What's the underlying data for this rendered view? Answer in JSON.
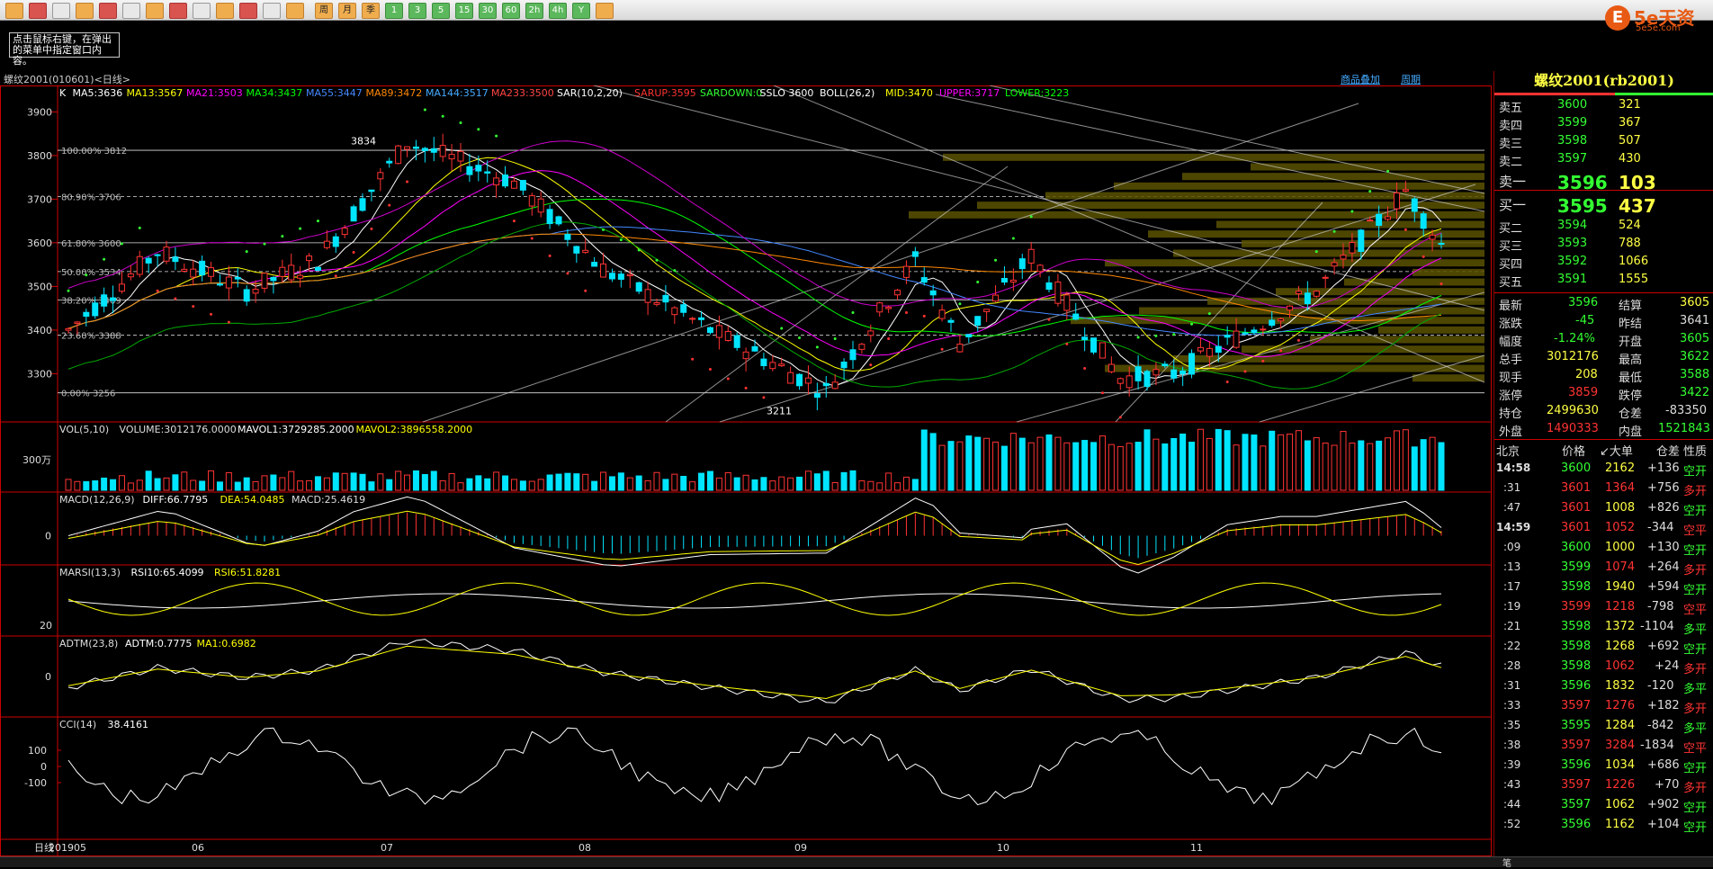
{
  "tip": "点击鼠标右键，在弹出的菜单中指定窗口内容。",
  "chart_header": {
    "name": "螺纹2001(010601)<日线>",
    "overlay": "商品叠加",
    "period": "周期"
  },
  "indicators": {
    "k": [
      [
        "K",
        "#fff"
      ],
      [
        "MA5:3636",
        "#fff"
      ],
      [
        "MA13:3567",
        "#ff0"
      ],
      [
        "MA21:3503",
        "#f0f"
      ],
      [
        "MA34:3437",
        "#0f0"
      ],
      [
        "MA55:3447",
        "#48f"
      ],
      [
        "MA89:3472",
        "#f80"
      ],
      [
        "MA144:3517",
        "#4af"
      ],
      [
        "MA233:3500",
        "#f44"
      ],
      [
        "SAR(10,2,20)",
        "#fff"
      ],
      [
        "SARUP:3595",
        "#f33"
      ],
      [
        "SARDOWN:0",
        "#3f3"
      ],
      [
        "SSLO 3600",
        "#fff"
      ],
      [
        "BOLL(26,2)",
        "#fff"
      ],
      [
        "MID:3470",
        "#ff0"
      ],
      [
        "UPPER:3717",
        "#f0f"
      ],
      [
        "LOWER:3223",
        "#0f0"
      ]
    ],
    "vol": [
      [
        "VOL(5,10)",
        "#ddd"
      ],
      [
        "VOLUME:3012176.0000",
        "#ddd"
      ],
      [
        "MAVOL1:3729285.2000",
        "#fff"
      ],
      [
        "MAVOL2:3896558.2000",
        "#ff0"
      ]
    ],
    "macd": [
      [
        "MACD(12,26,9)",
        "#ddd"
      ],
      [
        "DIFF:66.7795",
        "#fff"
      ],
      [
        "DEA:54.0485",
        "#ff0"
      ],
      [
        "MACD:25.4619",
        "#ddd"
      ]
    ],
    "rsi": [
      [
        "MARSI(13,3)",
        "#ddd"
      ],
      [
        "RSI10:65.4099",
        "#fff"
      ],
      [
        "RSI6:51.8281",
        "#ff0"
      ]
    ],
    "adtm": [
      [
        "ADTM(23,8)",
        "#ddd"
      ],
      [
        "ADTM:0.7775",
        "#fff"
      ],
      [
        "MA1:0.6982",
        "#ff0"
      ]
    ],
    "cci": [
      [
        "CCI(14)",
        "#ddd"
      ],
      [
        "38.4161",
        "#fff"
      ]
    ]
  },
  "price_axis": [
    "3900",
    "3800",
    "3700",
    "3600",
    "3500",
    "3400",
    "3300"
  ],
  "vol_axis": "300万",
  "macd_axis": "0",
  "rsi_axis": "20",
  "adtm_axis": "0",
  "cci_axis": [
    "100",
    "0",
    "-100"
  ],
  "fib": [
    "100.00% 3812",
    "80.90% 3706",
    "61.80% 3600",
    "50.00% 3534",
    "38.20% 3469",
    "23.60% 3388",
    "0.00% 3256"
  ],
  "high_mark": "3834",
  "low_mark": "3211",
  "x_axis": [
    "日线",
    "201905",
    "06",
    "07",
    "08",
    "09",
    "10",
    "11"
  ],
  "quote": {
    "title": "螺纹2001(rb2001)",
    "asks": [
      [
        "卖五",
        "3600",
        "321"
      ],
      [
        "卖四",
        "3599",
        "367"
      ],
      [
        "卖三",
        "3598",
        "507"
      ],
      [
        "卖二",
        "3597",
        "430"
      ],
      [
        "卖一",
        "3596",
        "103"
      ]
    ],
    "bids": [
      [
        "买一",
        "3595",
        "437"
      ],
      [
        "买二",
        "3594",
        "524"
      ],
      [
        "买三",
        "3593",
        "788"
      ],
      [
        "买四",
        "3592",
        "1066"
      ],
      [
        "买五",
        "3591",
        "1555"
      ]
    ],
    "stats": [
      [
        "最新",
        "3596",
        "结算",
        "3605",
        "c-g",
        "c-y"
      ],
      [
        "涨跌",
        "-45",
        "昨结",
        "3641",
        "c-g",
        "c-w"
      ],
      [
        "幅度",
        "-1.24%",
        "开盘",
        "3605",
        "c-g",
        "c-g"
      ],
      [
        "总手",
        "3012176",
        "最高",
        "3622",
        "c-y",
        "c-g"
      ],
      [
        "现手",
        "208",
        "最低",
        "3588",
        "c-y",
        "c-g"
      ],
      [
        "涨停",
        "3859",
        "跌停",
        "3422",
        "c-r",
        "c-g"
      ],
      [
        "持仓",
        "2499630",
        "仓差",
        "-83350",
        "c-y",
        "c-w"
      ],
      [
        "外盘",
        "1490333",
        "内盘",
        "1521843",
        "c-r",
        "c-g"
      ]
    ],
    "tick_header": [
      "北京",
      "价格",
      "↙大单",
      "仓差",
      "性质"
    ],
    "ticks": [
      [
        "14:58",
        "3600",
        "2162",
        "+136",
        "空开",
        "c-g",
        "c-g"
      ],
      [
        ":31",
        "3601",
        "1364",
        "+756",
        "多开",
        "c-r",
        "c-r"
      ],
      [
        ":47",
        "3601",
        "1008",
        "+826",
        "空开",
        "c-r",
        "c-g"
      ],
      [
        "14:59",
        "3601",
        "1052",
        "-344",
        "空平",
        "c-r",
        "c-r"
      ],
      [
        ":09",
        "3600",
        "1000",
        "+130",
        "空开",
        "c-g",
        "c-g"
      ],
      [
        ":13",
        "3599",
        "1074",
        "+264",
        "多开",
        "c-g",
        "c-r"
      ],
      [
        ":17",
        "3598",
        "1940",
        "+594",
        "空开",
        "c-g",
        "c-g"
      ],
      [
        ":19",
        "3599",
        "1218",
        "-798",
        "空平",
        "c-r",
        "c-r"
      ],
      [
        ":21",
        "3598",
        "1372",
        "-1104",
        "多平",
        "c-g",
        "c-g"
      ],
      [
        ":22",
        "3598",
        "1268",
        "+692",
        "空开",
        "c-g",
        "c-g"
      ],
      [
        ":28",
        "3598",
        "1062",
        "+24",
        "多开",
        "c-g",
        "c-r"
      ],
      [
        ":31",
        "3596",
        "1832",
        "-120",
        "多平",
        "c-g",
        "c-g"
      ],
      [
        ":33",
        "3597",
        "1276",
        "+182",
        "多开",
        "c-r",
        "c-r"
      ],
      [
        ":35",
        "3595",
        "1284",
        "-842",
        "多平",
        "c-g",
        "c-g"
      ],
      [
        ":38",
        "3597",
        "3284",
        "-1834",
        "空平",
        "c-r",
        "c-r"
      ],
      [
        ":39",
        "3596",
        "1034",
        "+686",
        "空开",
        "c-g",
        "c-g"
      ],
      [
        ":43",
        "3597",
        "1226",
        "+70",
        "多开",
        "c-r",
        "c-r"
      ],
      [
        ":44",
        "3597",
        "1062",
        "+902",
        "空开",
        "c-g",
        "c-g"
      ],
      [
        ":52",
        "3596",
        "1162",
        "+104",
        "空开",
        "c-g",
        "c-g"
      ]
    ],
    "bottom_tab": "笔"
  },
  "logo": {
    "mark": "E",
    "text": "5e天资",
    "sub": "5e5e.com"
  },
  "toolbar_buttons": [
    "周",
    "月",
    "季",
    "1",
    "3",
    "5",
    "15",
    "30",
    "60",
    "2h",
    "4h",
    "Y"
  ],
  "colors": {
    "up": "#ff3333",
    "down": "#00e5ff",
    "grid": "#cc0000",
    "bg": "#000000"
  }
}
